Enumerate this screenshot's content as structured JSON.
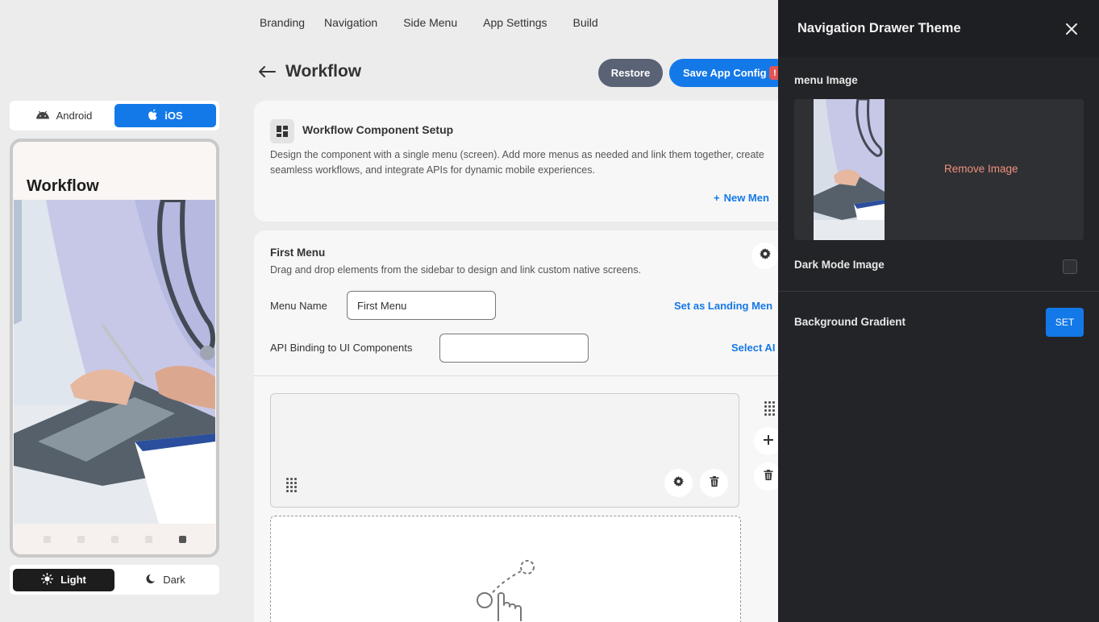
{
  "topnav": [
    "Branding",
    "Navigation",
    "Side Menu",
    "App Settings",
    "Build"
  ],
  "header": {
    "title": "Workflow",
    "restore_label": "Restore",
    "save_label": "Save App Config",
    "save_badge": "!"
  },
  "device": {
    "android_label": "Android",
    "ios_label": "iOS",
    "active": "iOS"
  },
  "preview": {
    "title": "Workflow"
  },
  "theme_toggle": {
    "light_label": "Light",
    "dark_label": "Dark",
    "active": "Light"
  },
  "setup_card": {
    "title": "Workflow Component Setup",
    "description": "Design the component with a single menu (screen). Add more menus as needed and link them together, create seamless workflows, and integrate APIs for dynamic mobile experiences.",
    "new_menu_label": "New Men"
  },
  "menu_card": {
    "title": "First Menu",
    "description": "Drag and drop elements from the sidebar to design and link custom native screens.",
    "menu_name_label": "Menu Name",
    "menu_name_value": "First Menu",
    "landing_label": "Set as Landing Men",
    "api_label": "API Binding to UI Components",
    "api_value": "",
    "select_api_label": "Select AI"
  },
  "drawer": {
    "title": "Navigation Drawer Theme",
    "menu_image_label": "menu Image",
    "remove_image_label": "Remove Image",
    "dark_mode_label": "Dark Mode Image",
    "gradient_label": "Background Gradient",
    "set_label": "SET"
  },
  "colors": {
    "accent": "#1479e8",
    "drawer_bg": "#232427",
    "remove": "#f0907d"
  }
}
